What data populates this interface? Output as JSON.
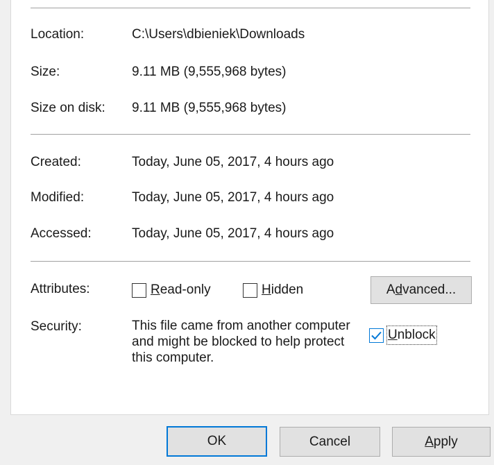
{
  "general": {
    "location": {
      "label": "Location:",
      "value": "C:\\Users\\dbieniek\\Downloads"
    },
    "size": {
      "label": "Size:",
      "value": "9.11 MB (9,555,968 bytes)"
    },
    "size_on_disk": {
      "label": "Size on disk:",
      "value": "9.11 MB (9,555,968 bytes)"
    },
    "created": {
      "label": "Created:",
      "value": "Today, June 05, 2017, 4 hours ago"
    },
    "modified": {
      "label": "Modified:",
      "value": "Today, June 05, 2017, 4 hours ago"
    },
    "accessed": {
      "label": "Accessed:",
      "value": "Today, June 05, 2017, 4 hours ago"
    }
  },
  "attributes": {
    "label": "Attributes:",
    "readonly": {
      "pre": "",
      "key": "R",
      "post": "ead-only",
      "checked": false
    },
    "hidden": {
      "pre": "",
      "key": "H",
      "post": "idden",
      "checked": false
    },
    "advanced": {
      "pre": "A",
      "key": "d",
      "post": "vanced..."
    }
  },
  "security": {
    "label": "Security:",
    "message": "This file came from another computer and might be blocked to help protect this computer.",
    "unblock": {
      "pre": "",
      "key": "U",
      "post": "nblock",
      "checked": true
    }
  },
  "buttons": {
    "ok": "OK",
    "cancel": "Cancel",
    "apply": {
      "pre": "",
      "key": "A",
      "post": "pply"
    }
  },
  "colors": {
    "accent": "#0078d7",
    "background": "#f0f0f0",
    "panel": "#ffffff"
  }
}
